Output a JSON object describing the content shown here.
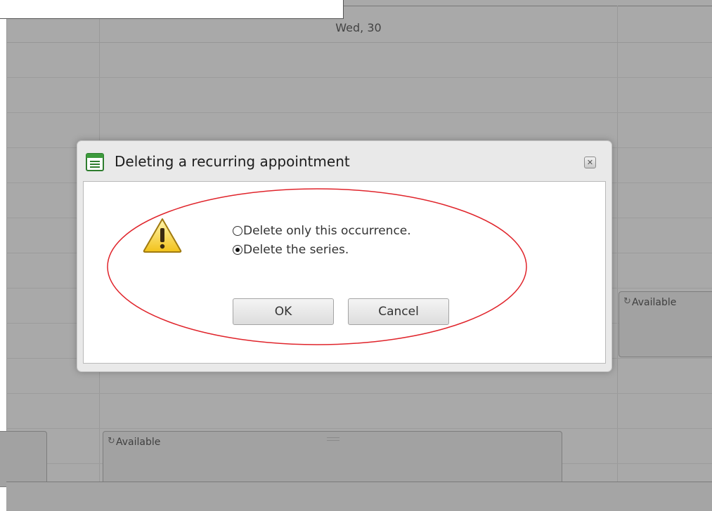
{
  "calendar": {
    "day_header": "Wed, 30",
    "appointments": [
      {
        "label": "Available",
        "icon": "recurrence-icon"
      },
      {
        "label": "Available",
        "icon": "recurrence-icon"
      }
    ]
  },
  "dialog": {
    "title": "Deleting a recurring appointment",
    "title_icon": "appointment-icon",
    "close_glyph": "✕",
    "warning_icon": "warning-icon",
    "options": [
      {
        "label": "Delete only this occurrence.",
        "checked": false
      },
      {
        "label": "Delete the series.",
        "checked": true
      }
    ],
    "ok_label": "OK",
    "cancel_label": "Cancel"
  },
  "colors": {
    "annotation": "#e0242b",
    "background": "#a9a9a9",
    "dialog": "#e9e9e9"
  }
}
